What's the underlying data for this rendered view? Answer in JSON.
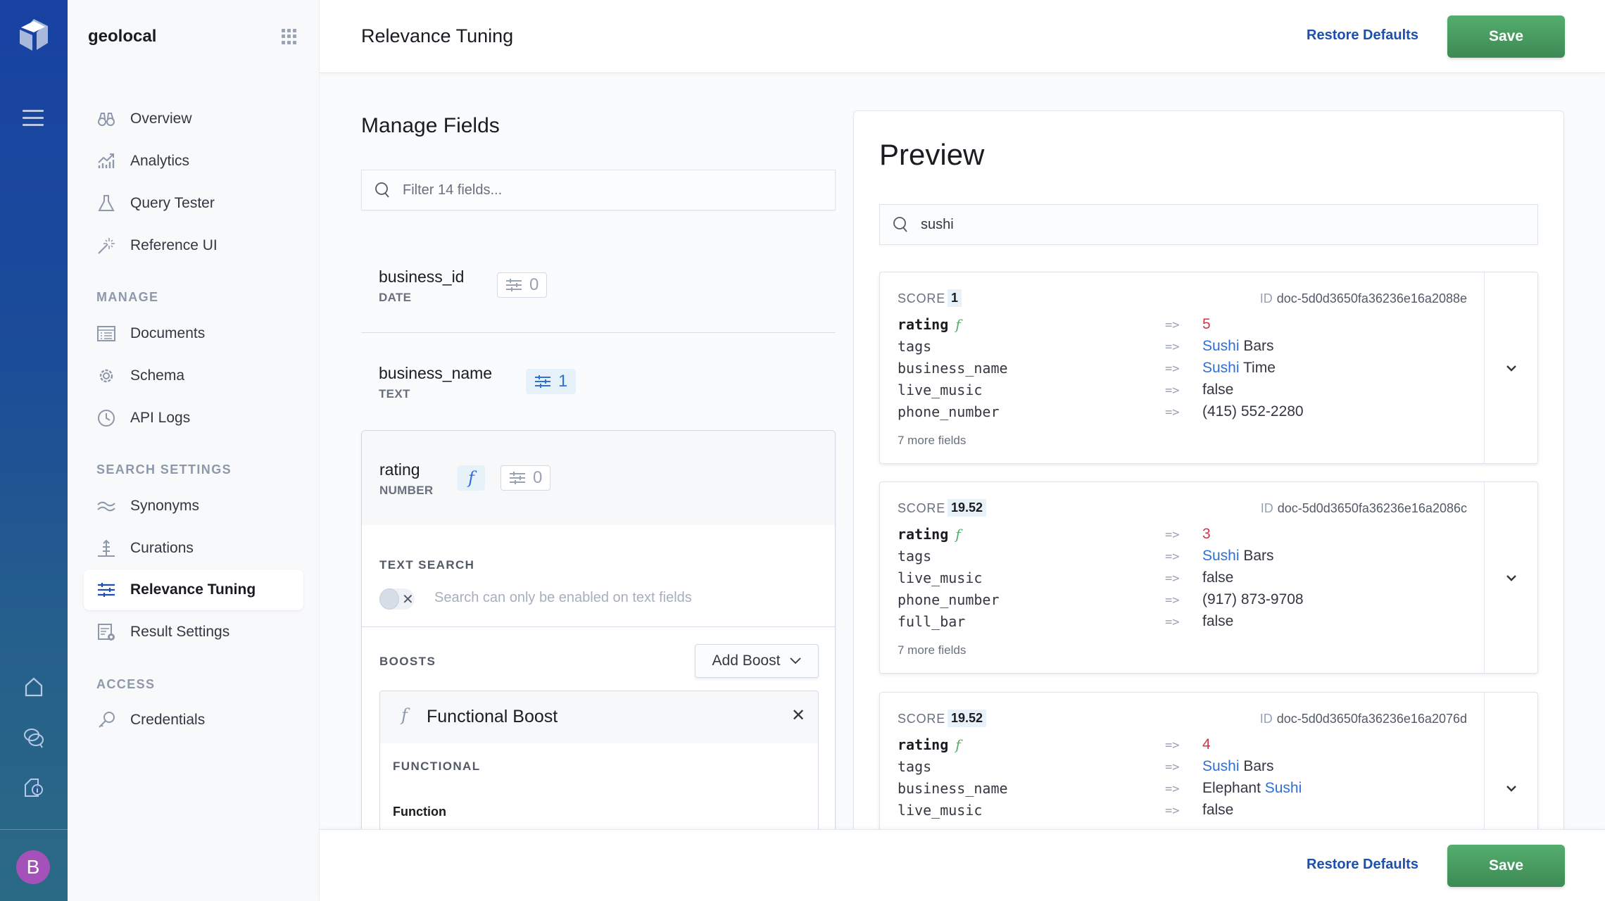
{
  "app": {
    "engine_name": "geolocal",
    "avatar_initial": "B",
    "colors": {
      "rail": "#1842a3",
      "accent": "#1d4fae",
      "save": "#3d8a55",
      "highlight": "#2f6fd6",
      "number": "#d1364b",
      "avatar": "#a451b9"
    }
  },
  "rail": {
    "icons": [
      "logo-icon",
      "menu-icon",
      "home-icon",
      "chat-icon",
      "document-info-icon"
    ]
  },
  "sidebar": {
    "top_items": [
      {
        "label": "Overview",
        "icon": "binoculars-icon"
      },
      {
        "label": "Analytics",
        "icon": "analytics-icon"
      },
      {
        "label": "Query Tester",
        "icon": "flask-icon"
      },
      {
        "label": "Reference UI",
        "icon": "magic-wand-icon"
      }
    ],
    "sections": [
      {
        "title": "MANAGE",
        "items": [
          {
            "label": "Documents",
            "icon": "documents-icon"
          },
          {
            "label": "Schema",
            "icon": "gear-icon"
          },
          {
            "label": "API Logs",
            "icon": "clock-icon"
          }
        ]
      },
      {
        "title": "SEARCH SETTINGS",
        "items": [
          {
            "label": "Synonyms",
            "icon": "synonyms-icon"
          },
          {
            "label": "Curations",
            "icon": "curations-icon"
          },
          {
            "label": "Relevance Tuning",
            "icon": "tuning-icon",
            "active": true
          },
          {
            "label": "Result Settings",
            "icon": "result-settings-icon"
          }
        ]
      },
      {
        "title": "ACCESS",
        "items": [
          {
            "label": "Credentials",
            "icon": "key-icon"
          }
        ]
      }
    ]
  },
  "header": {
    "title": "Relevance Tuning",
    "restore_label": "Restore Defaults",
    "save_label": "Save"
  },
  "manage_fields": {
    "title": "Manage Fields",
    "filter_placeholder": "Filter 14 fields...",
    "fields": [
      {
        "name": "business_id",
        "type": "DATE",
        "boosts": "0",
        "active": false
      },
      {
        "name": "business_name",
        "type": "TEXT",
        "boosts": "1",
        "active": true
      },
      {
        "name": "rating",
        "type": "NUMBER",
        "boosts": "0",
        "has_function": true,
        "function_glyph": "f"
      }
    ],
    "expanded": {
      "text_search_label": "TEXT SEARCH",
      "text_search_enabled": false,
      "text_search_note": "Search can only be enabled on text fields",
      "boosts_label": "BOOSTS",
      "add_boost_label": "Add Boost",
      "boost": {
        "title": "Functional Boost",
        "glyph": "f",
        "section_label": "FUNCTIONAL",
        "function_label": "Function",
        "function_value": ""
      }
    }
  },
  "preview": {
    "title": "Preview",
    "query": "sushi",
    "score_label": "SCORE",
    "id_label": "ID",
    "arrow": "=>",
    "results": [
      {
        "score": "1",
        "id": "doc-5d0d3650fa36236e16a2088e",
        "fields": [
          {
            "key": "rating",
            "value": "5",
            "kind": "number",
            "function": true
          },
          {
            "key": "tags",
            "highlight": "Sushi",
            "value": " Bars",
            "kind": "text"
          },
          {
            "key": "business_name",
            "highlight": "Sushi",
            "value": " Time",
            "kind": "text"
          },
          {
            "key": "live_music",
            "value": "false",
            "kind": "plain"
          },
          {
            "key": "phone_number",
            "value": "(415) 552-2280",
            "kind": "plain"
          }
        ],
        "more": "7 more fields"
      },
      {
        "score": "19.52",
        "id": "doc-5d0d3650fa36236e16a2086c",
        "fields": [
          {
            "key": "rating",
            "value": "3",
            "kind": "number",
            "function": true
          },
          {
            "key": "tags",
            "highlight": "Sushi",
            "value": " Bars",
            "kind": "text"
          },
          {
            "key": "live_music",
            "value": "false",
            "kind": "plain"
          },
          {
            "key": "phone_number",
            "value": "(917) 873-9708",
            "kind": "plain"
          },
          {
            "key": "full_bar",
            "value": "false",
            "kind": "plain"
          }
        ],
        "more": "7 more fields"
      },
      {
        "score": "19.52",
        "id": "doc-5d0d3650fa36236e16a2076d",
        "fields": [
          {
            "key": "rating",
            "value": "4",
            "kind": "number",
            "function": true
          },
          {
            "key": "tags",
            "highlight": "Sushi",
            "value": " Bars",
            "kind": "text"
          },
          {
            "key": "business_name",
            "prefix": "Elephant ",
            "highlight": "Sushi",
            "value": "",
            "kind": "text"
          },
          {
            "key": "live_music",
            "value": "false",
            "kind": "plain"
          }
        ],
        "more": ""
      }
    ]
  },
  "footer": {
    "restore_label": "Restore Defaults",
    "save_label": "Save"
  }
}
